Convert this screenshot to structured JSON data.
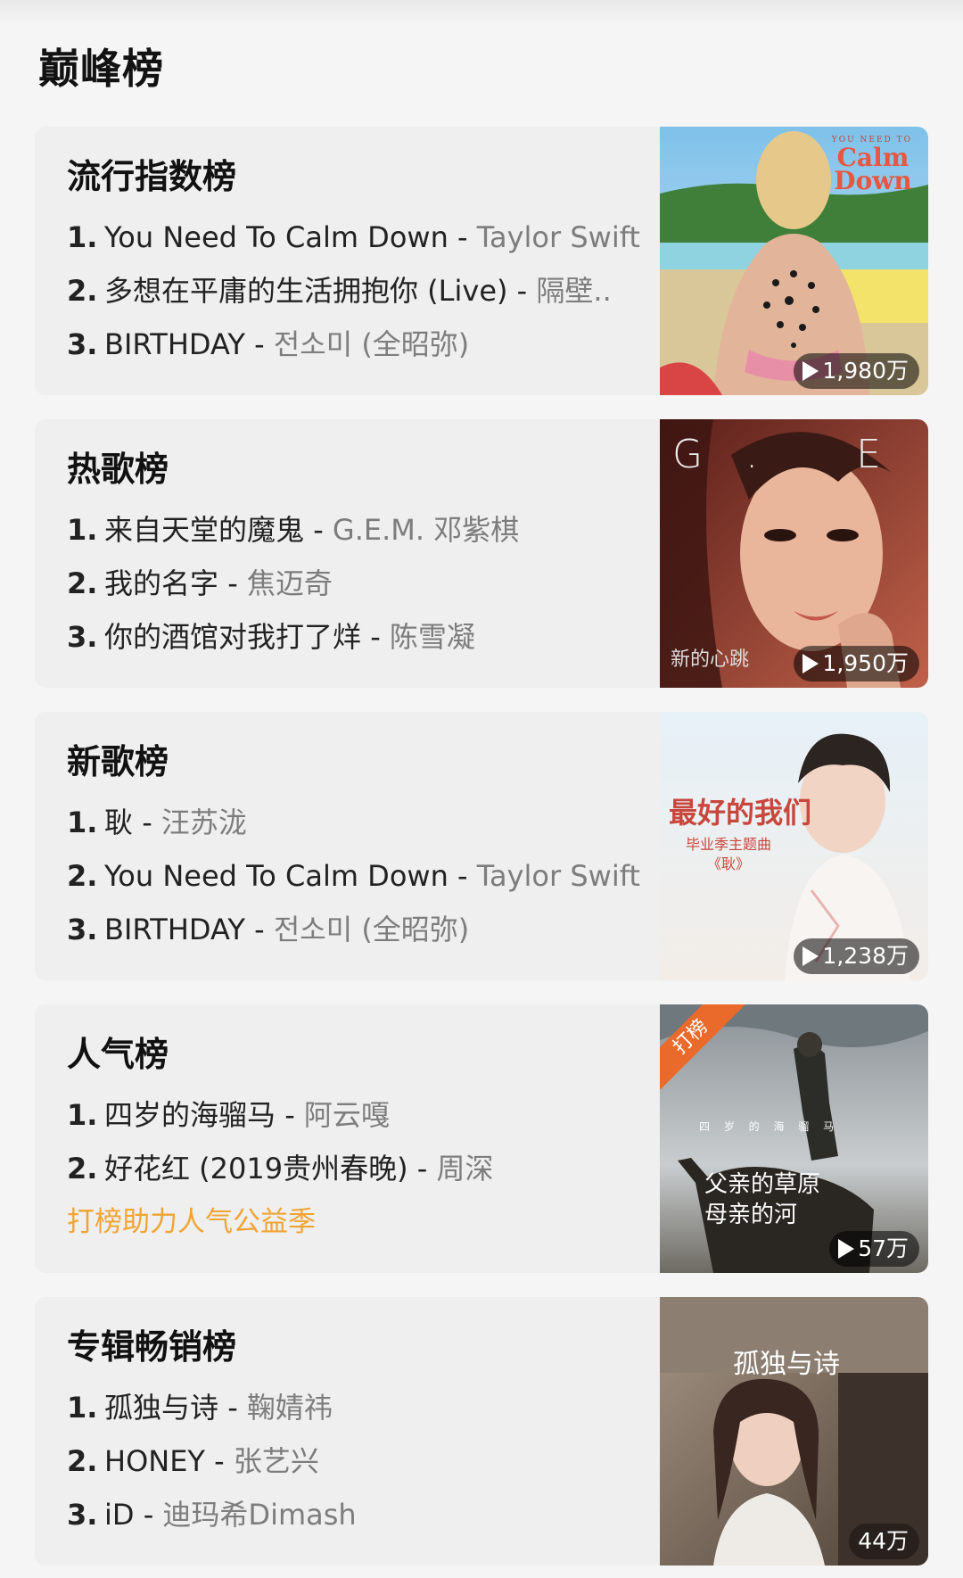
{
  "page": {
    "title": "巅峰榜"
  },
  "charts": [
    {
      "title": "流行指数榜",
      "songs": [
        {
          "rank": "1.",
          "name": "You Need To Calm Down",
          "sep": " - ",
          "artist": "Taylor Swift"
        },
        {
          "rank": "2.",
          "name": "多想在平庸的生活拥抱你 (Live)",
          "sep": " - ",
          "artist": "隔壁.."
        },
        {
          "rank": "3.",
          "name": "BIRTHDAY",
          "sep": " - ",
          "artist": "전소미 (全昭弥)"
        }
      ],
      "plays": "1,980万",
      "cover": {
        "icon": "calm-down-cover",
        "text": "Calm Down",
        "small_text": "YOU NEED TO",
        "accent": "#e8563f"
      }
    },
    {
      "title": "热歌榜",
      "songs": [
        {
          "rank": "1.",
          "name": "来自天堂的魔鬼",
          "sep": " - ",
          "artist": "G.E.M. 邓紫棋"
        },
        {
          "rank": "2.",
          "name": "我的名字",
          "sep": " - ",
          "artist": "焦迈奇"
        },
        {
          "rank": "3.",
          "name": "你的酒馆对我打了烊",
          "sep": " - ",
          "artist": "陈雪凝"
        }
      ],
      "plays": "1,950万",
      "cover": {
        "icon": "gem-cover",
        "text": "G. E. M.",
        "small_text": "新的心跳",
        "accent": "#b04a38"
      }
    },
    {
      "title": "新歌榜",
      "songs": [
        {
          "rank": "1.",
          "name": "耿",
          "sep": " - ",
          "artist": "汪苏泷"
        },
        {
          "rank": "2.",
          "name": "You Need To Calm Down",
          "sep": " - ",
          "artist": "Taylor Swift"
        },
        {
          "rank": "3.",
          "name": "BIRTHDAY",
          "sep": " - ",
          "artist": "전소미 (全昭弥)"
        }
      ],
      "plays": "1,238万",
      "cover": {
        "icon": "geng-cover",
        "text": "最好的我们",
        "small_text": "毕业季主题曲 《耿》",
        "accent": "#c9463d"
      }
    },
    {
      "title": "人气榜",
      "songs": [
        {
          "rank": "1.",
          "name": "四岁的海骝马",
          "sep": " - ",
          "artist": "阿云嘎"
        },
        {
          "rank": "2.",
          "name": "好花红 (2019贵州春晚)",
          "sep": " - ",
          "artist": "周深"
        }
      ],
      "promo": "打榜助力人气公益季",
      "plays": "57万",
      "cover": {
        "icon": "horse-cover",
        "text": "父亲的草原 母亲的河",
        "small_text": "四 岁 的 海 骝 马",
        "ribbon": "打榜",
        "accent": "#e96a2b"
      }
    },
    {
      "title": "专辑畅销榜",
      "songs": [
        {
          "rank": "1.",
          "name": "孤独与诗",
          "sep": " - ",
          "artist": "鞠婧祎"
        },
        {
          "rank": "2.",
          "name": "HONEY",
          "sep": " - ",
          "artist": "张艺兴"
        },
        {
          "rank": "3.",
          "name": "iD",
          "sep": " - ",
          "artist": "迪玛希Dimash"
        }
      ],
      "plays": "44万",
      "cover": {
        "icon": "loneliness-poetry-cover",
        "text": "孤独与诗",
        "accent": "#6a5a4f"
      }
    }
  ],
  "colors": {
    "background": "#f5f5f5",
    "card": "#efefef",
    "artist": "#7d7d7d",
    "promo": "#f0a433"
  }
}
